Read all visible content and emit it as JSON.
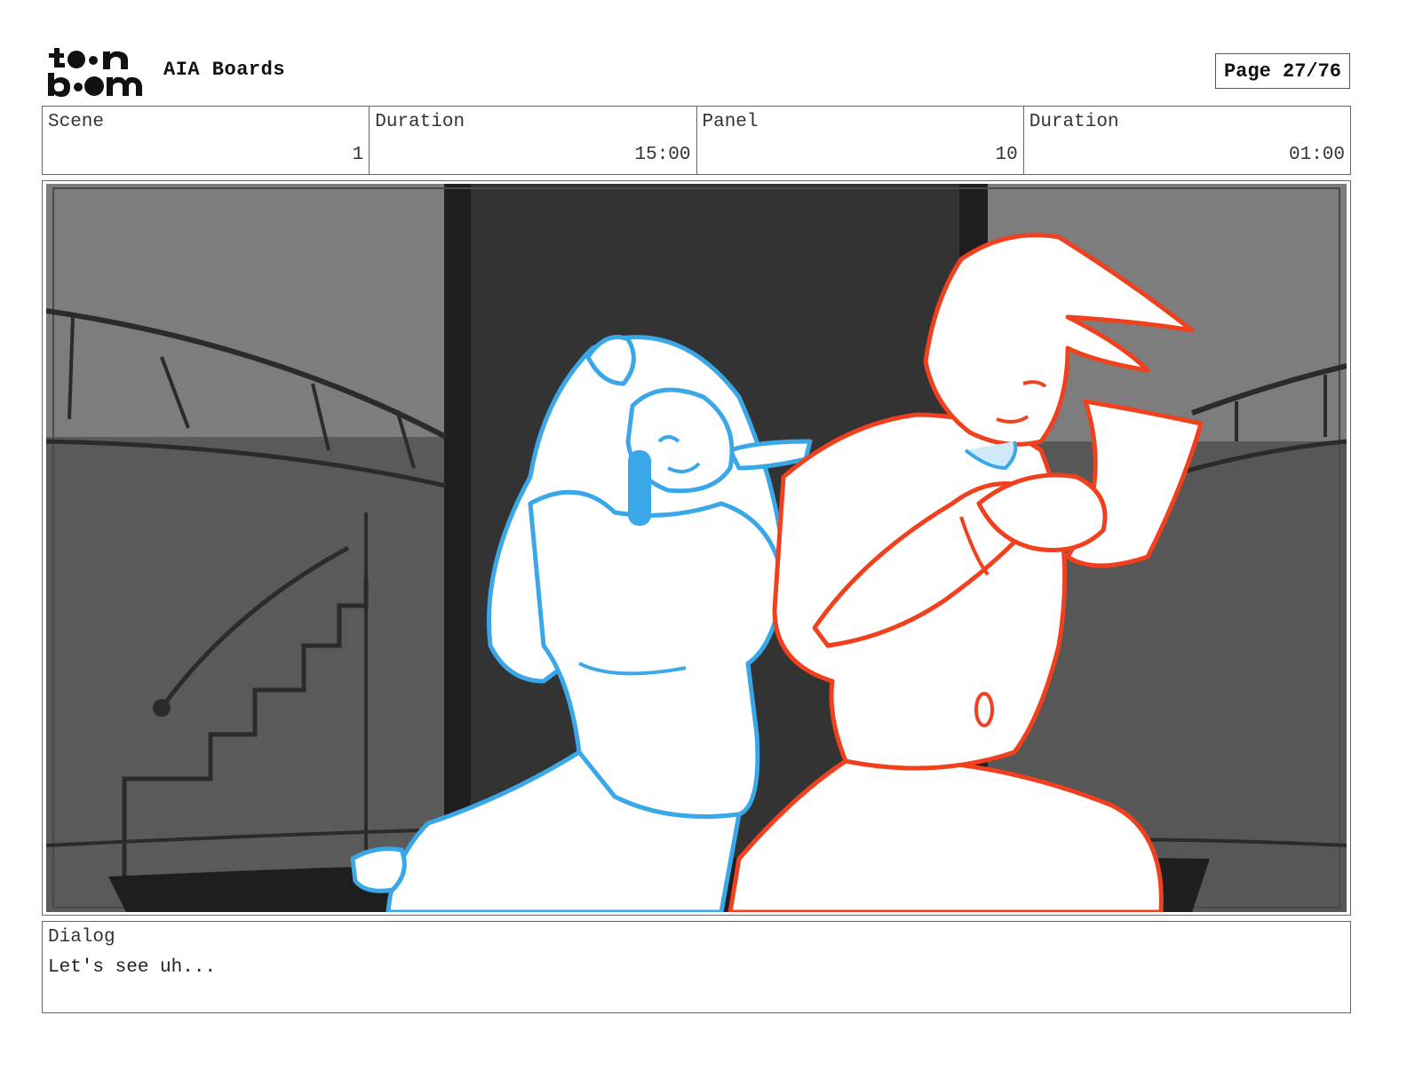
{
  "header": {
    "project_title": "AIA Boards",
    "page": "Page 27/76",
    "logo_icon": "toon-boom-logo"
  },
  "info": {
    "scene_label": "Scene",
    "scene_value": "1",
    "scene_duration_label": "Duration",
    "scene_duration_value": "15:00",
    "panel_label": "Panel",
    "panel_value": "10",
    "panel_duration_label": "Duration",
    "panel_duration_value": "01:00"
  },
  "panel": {
    "image_icon": "storyboard-sketch-image",
    "colors": {
      "background_light": "#7d7d7d",
      "background_dark": "#3a3a3a",
      "doorway": "#333333",
      "character_left": "#3aa7e8",
      "character_right": "#f0401e"
    }
  },
  "dialog": {
    "label": "Dialog",
    "text": "Let's see uh..."
  }
}
